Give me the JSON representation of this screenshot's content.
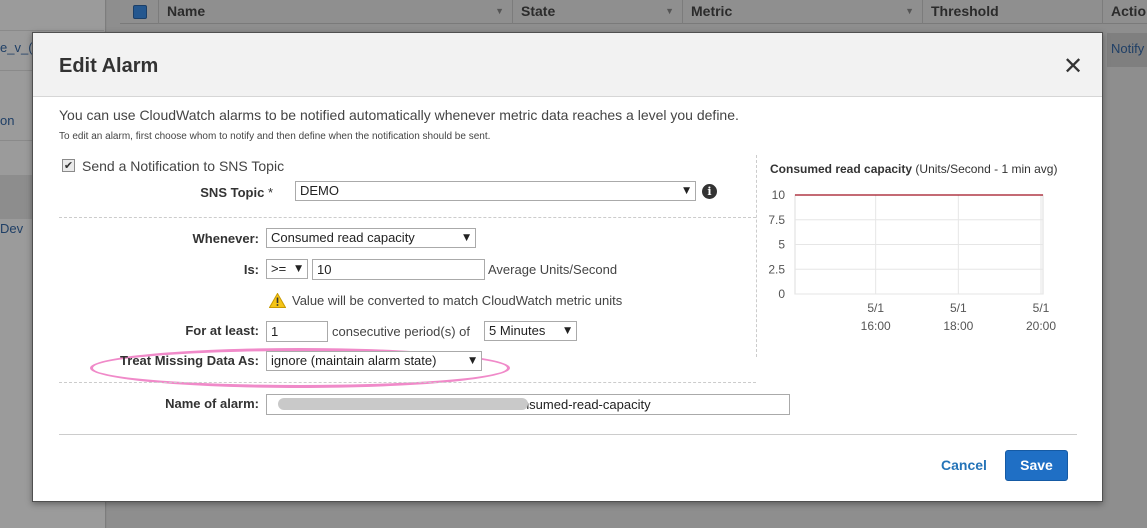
{
  "background": {
    "left_items": [
      "e_v_(",
      "on",
      "Dev"
    ],
    "table_headers": [
      "Name",
      "State",
      "Metric",
      "Threshold",
      "Actio"
    ],
    "row_action": "Notify"
  },
  "modal": {
    "title": "Edit Alarm",
    "close_symbol": "✕",
    "intro": "You can use CloudWatch alarms to be notified automatically whenever metric data reaches a level you define.",
    "intro_sub": "To edit an alarm, first choose whom to notify and then define when the notification should be sent.",
    "notify": {
      "checkbox_label": "Send a Notification to SNS Topic",
      "checked_symbol": "✔",
      "topic_label": "SNS Topic",
      "required_mark": "*",
      "topic_value": "DEMO",
      "info_symbol": "i"
    },
    "condition": {
      "whenever_label": "Whenever:",
      "whenever_value": "Consumed read capacity",
      "is_label": "Is:",
      "operator_value": ">=",
      "threshold_value": "10",
      "threshold_unit": "Average Units/Second",
      "warning_text": "Value will be converted to match CloudWatch metric units",
      "for_at_least_label": "For at least:",
      "periods_value": "1",
      "periods_text": "consecutive period(s) of",
      "period_length_value": "5 Minutes",
      "missing_data_label": "Treat Missing Data As:",
      "missing_data_value": "ignore (maintain alarm state)"
    },
    "name": {
      "label": "Name of alarm:",
      "value_visible": "-Consumed-read-capacity",
      "value_prefix_visible": "-"
    },
    "buttons": {
      "cancel": "Cancel",
      "save": "Save"
    },
    "accent_color": "#1f6fc5",
    "highlight_color": "#f08ac9"
  },
  "chart_data": {
    "type": "line",
    "title": "Consumed read capacity",
    "subtitle": "(Units/Second - 1 min avg)",
    "yticks": [
      "10",
      "7.5",
      "5",
      "2.5",
      "0"
    ],
    "ylim": [
      0,
      10
    ],
    "xticks": [
      {
        "date": "5/1",
        "time": "16:00"
      },
      {
        "date": "5/1",
        "time": "18:00"
      },
      {
        "date": "5/1",
        "time": "20:00"
      }
    ],
    "series": [
      {
        "values": [
          10,
          10,
          10,
          10
        ],
        "color": "#a01020"
      }
    ],
    "grid": true
  }
}
